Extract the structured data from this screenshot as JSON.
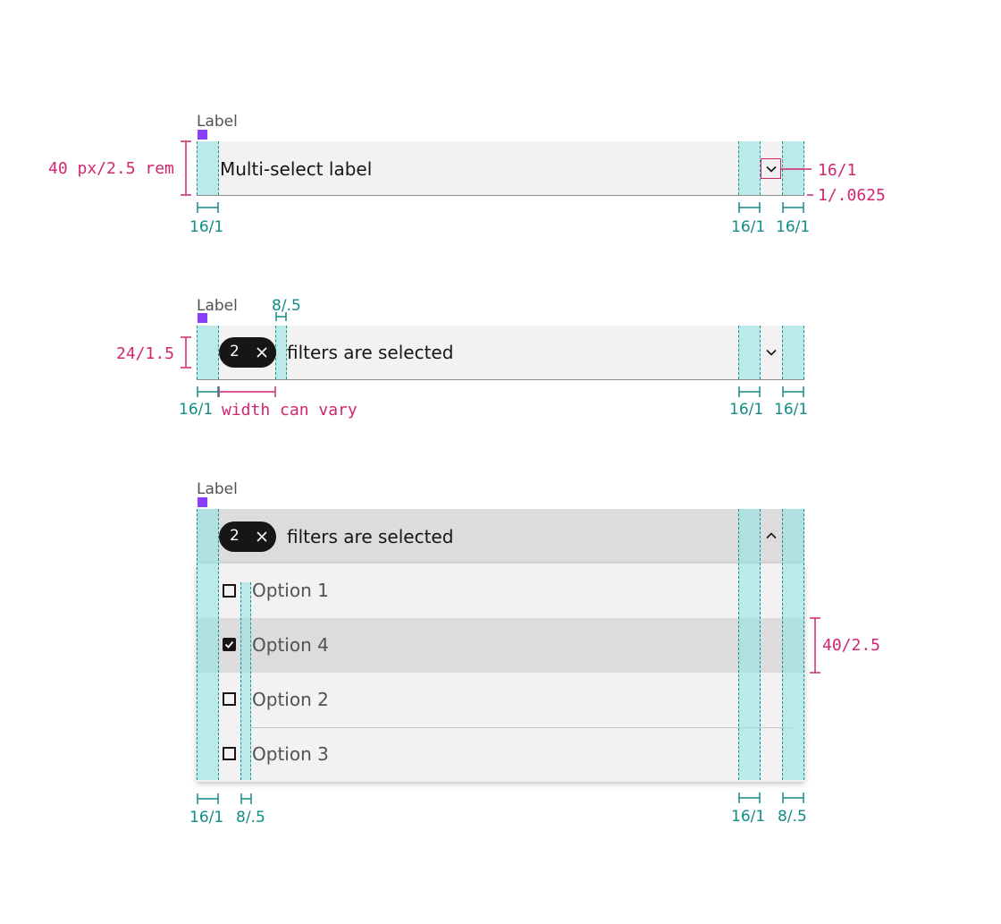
{
  "label_text": "Label",
  "example1": {
    "field_placeholder": "Multi-select label",
    "height_spec": "40 px/2.5 rem",
    "icon_spec": "16/1",
    "border_spec": "1/.0625",
    "left_padding": "16/1",
    "right_padding_a": "16/1",
    "right_padding_b": "16/1"
  },
  "example2": {
    "tag_count": "2",
    "field_text": "filters are selected",
    "tag_height_spec": "24/1.5",
    "tag_gap_spec": "8/.5",
    "left_padding": "16/1",
    "width_note": "width can vary",
    "right_padding_a": "16/1",
    "right_padding_b": "16/1"
  },
  "example3": {
    "tag_count": "2",
    "field_text": "filters are selected",
    "options": [
      {
        "label": "Option 1",
        "checked": false
      },
      {
        "label": "Option 4",
        "checked": true
      },
      {
        "label": "Option 2",
        "checked": false
      },
      {
        "label": "Option 3",
        "checked": false
      }
    ],
    "row_height_spec": "40/2.5",
    "left_padding": "16/1",
    "checkbox_gap": "8/.5",
    "right_padding_a": "16/1",
    "right_padding_b": "8/.5"
  },
  "colors": {
    "spec_teal": "#108c88",
    "spec_magenta": "#d02670",
    "label_marker": "#8a3ffc",
    "padding_highlight": "#8fe4e6"
  }
}
